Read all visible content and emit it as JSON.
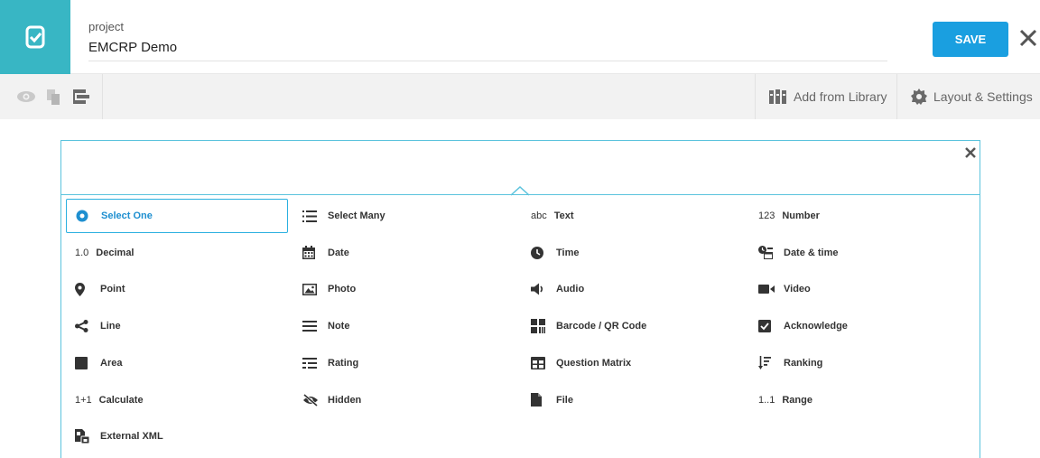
{
  "header": {
    "project_label": "project",
    "project_name": "EMCRP Demo",
    "save_label": "SAVE"
  },
  "toolbar": {
    "left_icons": [
      "eye-icon",
      "copy-icon",
      "structure-icon"
    ],
    "library_label": "Add from Library",
    "settings_label": "Layout & Settings"
  },
  "question_types": [
    {
      "label": "Select One",
      "icon": "radio-icon",
      "icon_text": "",
      "selected": true
    },
    {
      "label": "Select Many",
      "icon": "list-icon",
      "icon_text": ""
    },
    {
      "label": "Text",
      "icon": "text-icon",
      "icon_text": "abc"
    },
    {
      "label": "Number",
      "icon": "number-icon",
      "icon_text": "123"
    },
    {
      "label": "Decimal",
      "icon": "decimal-icon",
      "icon_text": "1.0"
    },
    {
      "label": "Date",
      "icon": "calendar-icon",
      "icon_text": ""
    },
    {
      "label": "Time",
      "icon": "clock-icon",
      "icon_text": ""
    },
    {
      "label": "Date & time",
      "icon": "datetime-icon",
      "icon_text": ""
    },
    {
      "label": "Point",
      "icon": "map-pin-icon",
      "icon_text": ""
    },
    {
      "label": "Photo",
      "icon": "photo-icon",
      "icon_text": ""
    },
    {
      "label": "Audio",
      "icon": "speaker-icon",
      "icon_text": ""
    },
    {
      "label": "Video",
      "icon": "video-icon",
      "icon_text": ""
    },
    {
      "label": "Line",
      "icon": "share-icon",
      "icon_text": ""
    },
    {
      "label": "Note",
      "icon": "note-lines-icon",
      "icon_text": ""
    },
    {
      "label": "Barcode / QR Code",
      "icon": "qr-code-icon",
      "icon_text": ""
    },
    {
      "label": "Acknowledge",
      "icon": "checkbox-icon",
      "icon_text": ""
    },
    {
      "label": "Area",
      "icon": "square-icon",
      "icon_text": ""
    },
    {
      "label": "Rating",
      "icon": "rating-icon",
      "icon_text": ""
    },
    {
      "label": "Question Matrix",
      "icon": "matrix-icon",
      "icon_text": ""
    },
    {
      "label": "Ranking",
      "icon": "ranking-icon",
      "icon_text": ""
    },
    {
      "label": "Calculate",
      "icon": "calculate-icon",
      "icon_text": "1+1"
    },
    {
      "label": "Hidden",
      "icon": "eye-slash-icon",
      "icon_text": ""
    },
    {
      "label": "File",
      "icon": "file-icon",
      "icon_text": ""
    },
    {
      "label": "Range",
      "icon": "range-icon",
      "icon_text": "1..1"
    },
    {
      "label": "External XML",
      "icon": "external-xml-icon",
      "icon_text": ""
    }
  ],
  "colors": {
    "brand": "#38b6c4",
    "save_button": "#1a9fe0",
    "accent_border": "#5bc3dd",
    "selected_text": "#1e8fd0"
  }
}
